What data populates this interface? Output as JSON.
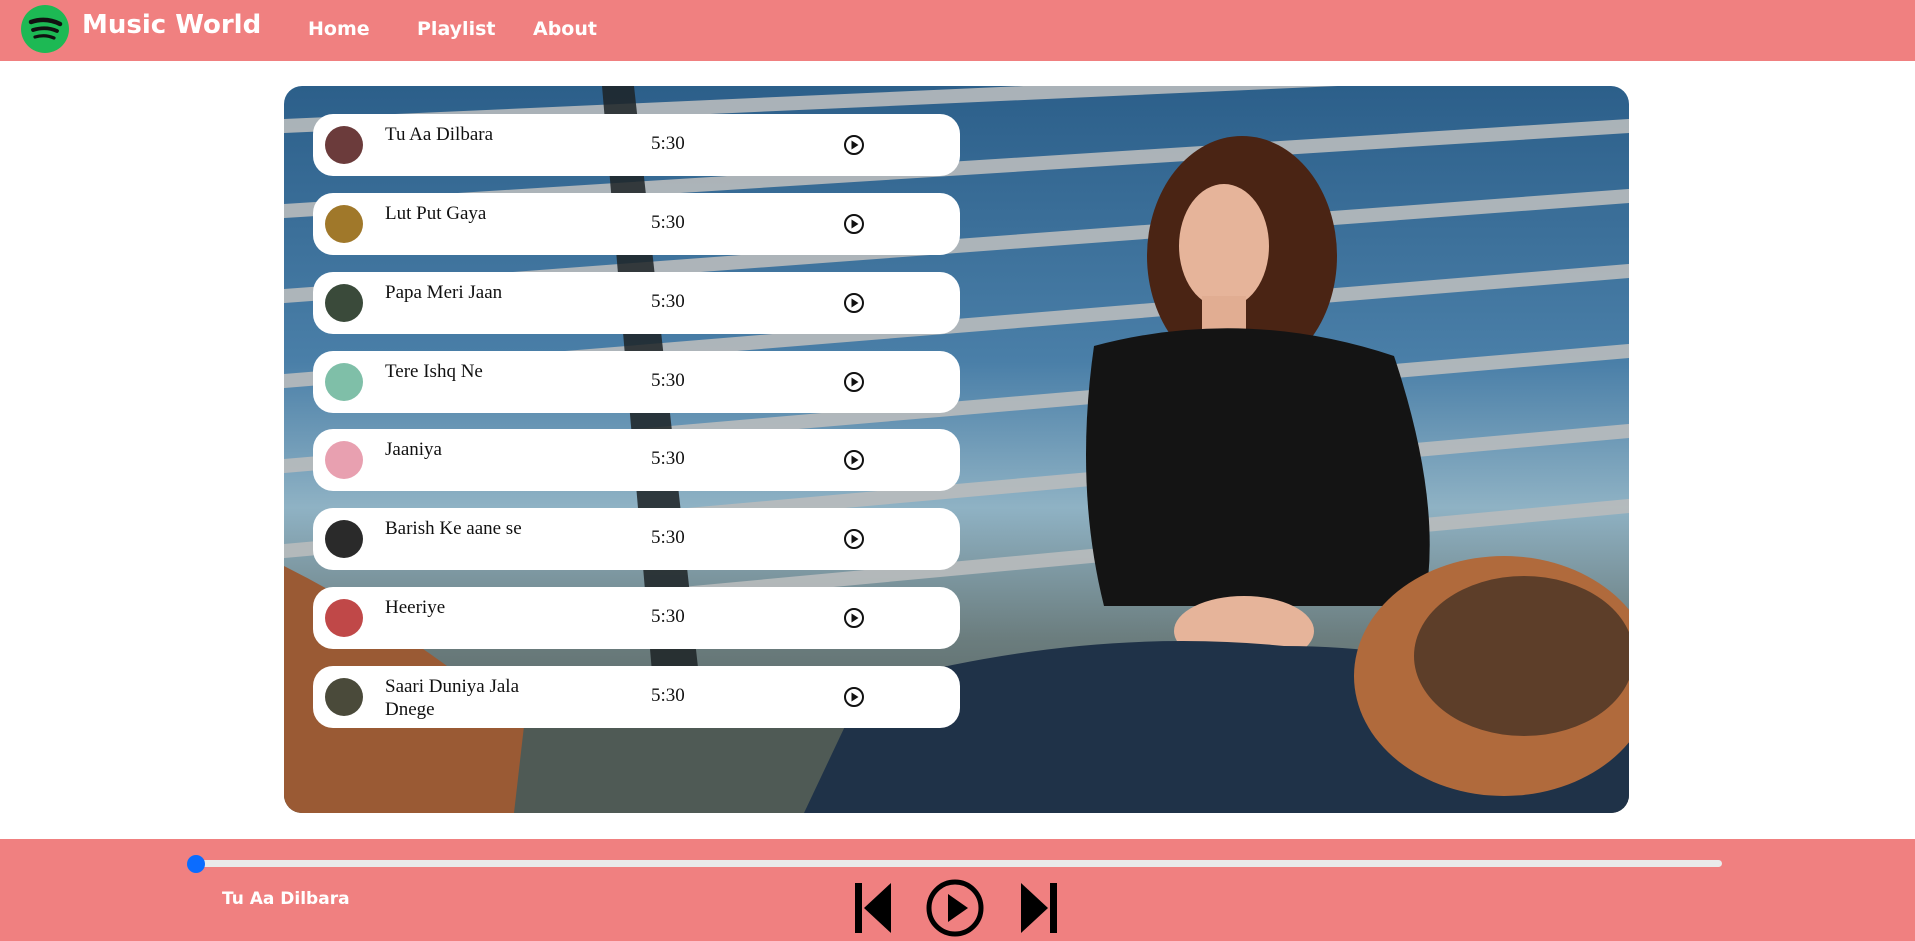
{
  "app": {
    "brand": "Music World",
    "brand_color": "#1db954",
    "accent": "#f08080"
  },
  "nav": {
    "links": [
      {
        "label": "Home"
      },
      {
        "label": "Playlist"
      },
      {
        "label": "About"
      }
    ]
  },
  "songs": [
    {
      "name": "Tu Aa Dilbara",
      "duration": "5:30",
      "cover_color": "#6b3b3b",
      "icon": "play-circle-icon"
    },
    {
      "name": "Lut Put Gaya",
      "duration": "5:30",
      "cover_color": "#a0782a",
      "icon": "play-circle-icon"
    },
    {
      "name": "Papa Meri Jaan",
      "duration": "5:30",
      "cover_color": "#3a4a3a",
      "icon": "play-circle-icon"
    },
    {
      "name": "Tere Ishq Ne",
      "duration": "5:30",
      "cover_color": "#7fbfa8",
      "icon": "play-circle-icon"
    },
    {
      "name": "Jaaniya",
      "duration": "5:30",
      "cover_color": "#e8a0b0",
      "icon": "play-circle-icon"
    },
    {
      "name": "Barish Ke aane se",
      "duration": "5:30",
      "cover_color": "#2a2a2a",
      "icon": "play-circle-icon"
    },
    {
      "name": "Heeriye",
      "duration": "5:30",
      "cover_color": "#c04848",
      "icon": "play-circle-icon"
    },
    {
      "name": "Saari Duniya Jala Dnege",
      "duration": "5:30",
      "cover_color": "#4a4a3a",
      "icon": "play-circle-icon"
    }
  ],
  "player": {
    "now_playing": "Tu Aa Dilbara",
    "progress_fraction": 0,
    "progress_color": "#0b6cff",
    "controls": [
      "previous-icon",
      "play-circle-icon",
      "next-icon"
    ]
  }
}
